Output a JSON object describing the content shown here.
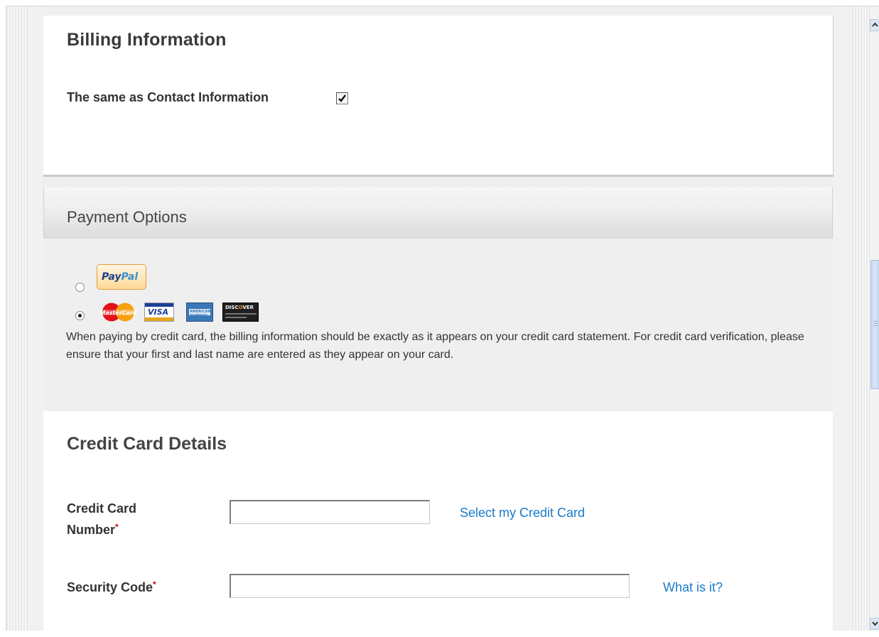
{
  "billing": {
    "title": "Billing Information",
    "same_as_contact_label": "The same as Contact Information",
    "same_as_contact_checked": true
  },
  "payment": {
    "title": "Payment Options",
    "paypal_label": "PayPal",
    "selected_option": "credit-card",
    "card_logos": [
      "MasterCard",
      "VISA",
      "American Express",
      "DISCOVER"
    ],
    "note": "When paying by credit card, the billing information should be exactly as it appears on your credit card statement. For credit card verification, please ensure that your first and last name are entered as they appear on your card."
  },
  "credit_card": {
    "title": "Credit Card Details",
    "number_label_line1": "Credit Card",
    "number_label_line2": "Number",
    "number_value": "",
    "select_link": "Select my Credit Card",
    "security_label": "Security Code",
    "security_value": "",
    "what_link": "What is it?",
    "required_marker": "*"
  },
  "colors": {
    "link": "#1a7bc9",
    "required": "#cc0000",
    "background": "#efefef"
  }
}
